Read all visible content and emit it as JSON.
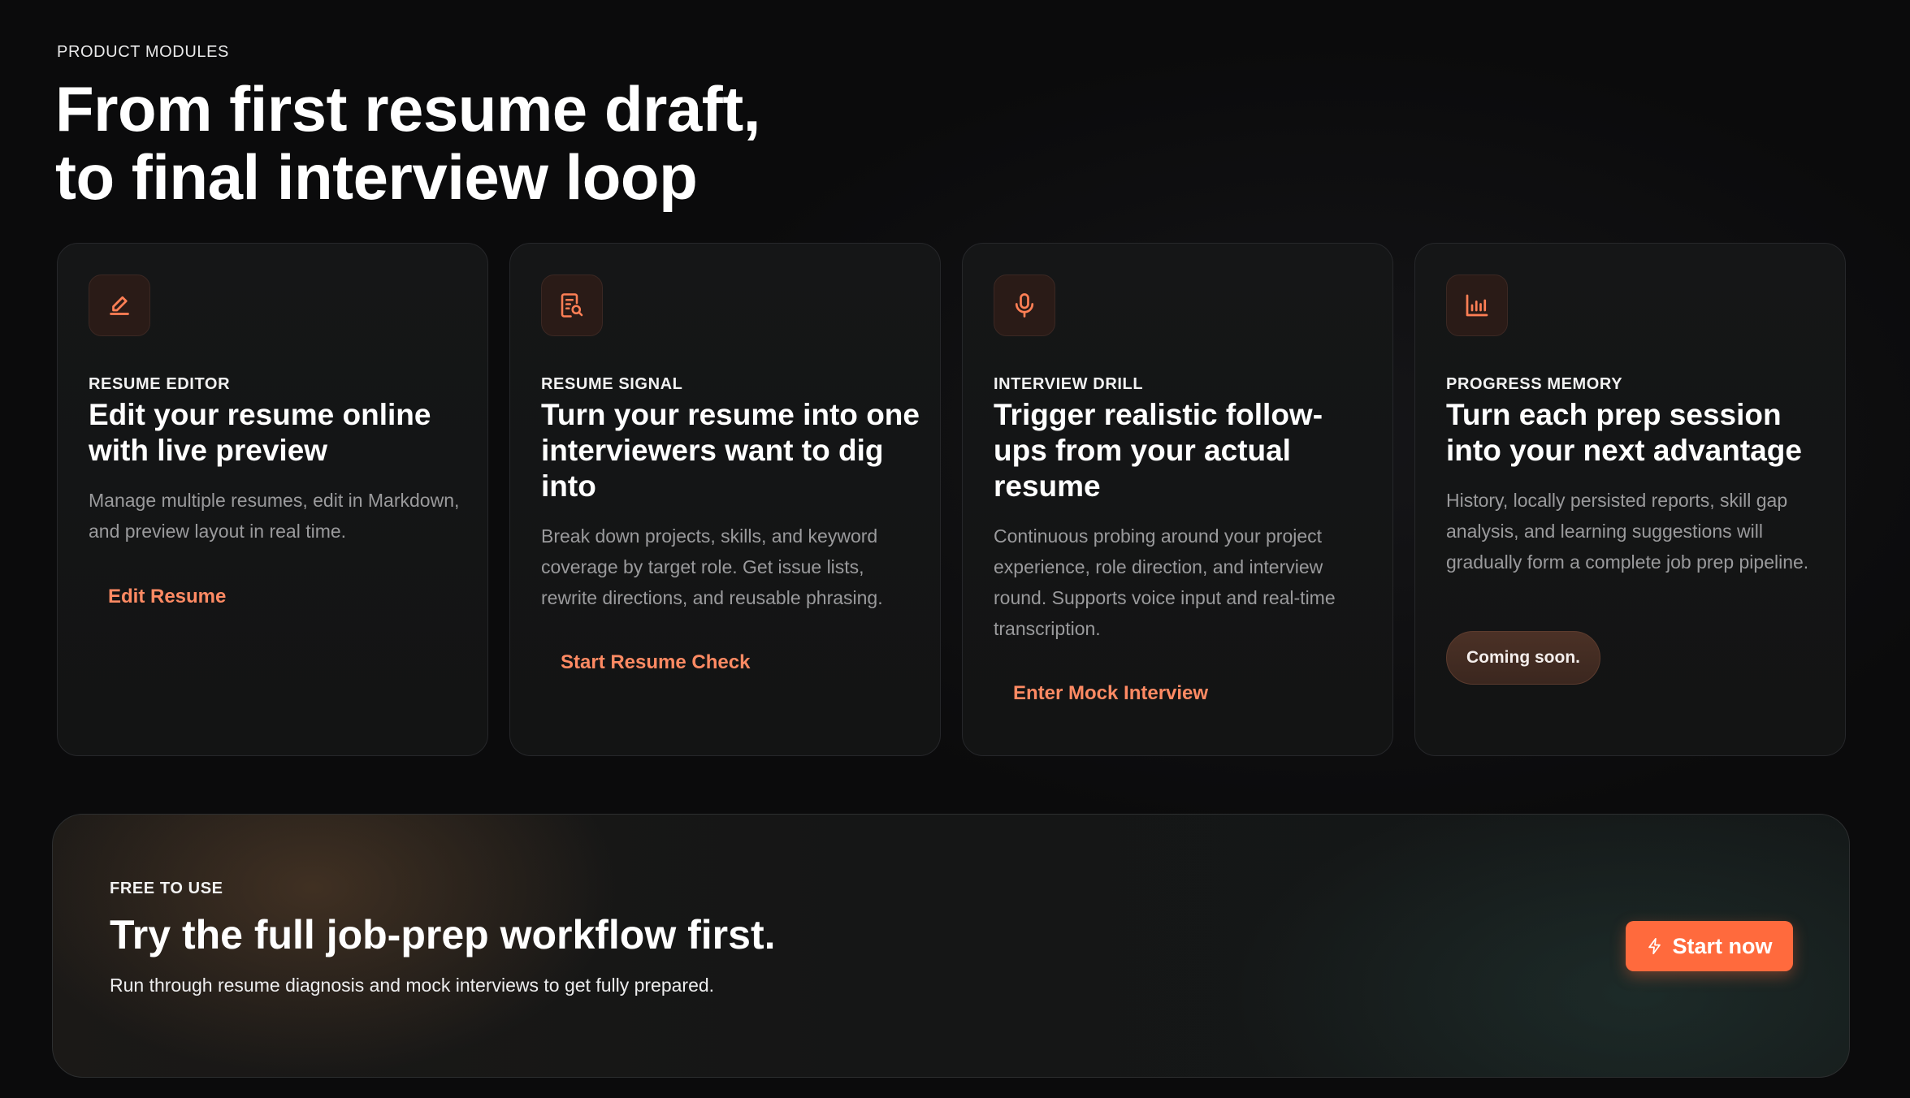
{
  "header": {
    "eyebrow": "PRODUCT MODULES",
    "headline_line1": "From first resume draft,",
    "headline_line2": "to final interview loop"
  },
  "cards": [
    {
      "icon": "pencil-icon",
      "kicker": "RESUME EDITOR",
      "title": "Edit your resume online with live preview",
      "description": "Manage multiple resumes, edit in Markdown, and preview layout in real time.",
      "link_label": "Edit Resume"
    },
    {
      "icon": "resume-search-icon",
      "kicker": "RESUME SIGNAL",
      "title": "Turn your resume into one interviewers want to dig into",
      "description": "Break down projects, skills, and keyword coverage by target role. Get issue lists, rewrite directions, and reusable phrasing.",
      "link_label": "Start Resume Check"
    },
    {
      "icon": "microphone-icon",
      "kicker": "INTERVIEW DRILL",
      "title": "Trigger realistic follow-ups from your actual resume",
      "description": "Continuous probing around your project experience, role direction, and interview round. Supports voice input and real-time transcription.",
      "link_label": "Enter Mock Interview"
    },
    {
      "icon": "bar-chart-icon",
      "kicker": "PROGRESS MEMORY",
      "title": "Turn each prep session into your next advantage",
      "description": "History, locally persisted reports, skill gap analysis, and learning suggestions will gradually form a complete job prep pipeline.",
      "badge_label": "Coming soon."
    }
  ],
  "cta": {
    "eyebrow": "FREE TO USE",
    "title": "Try the full job-prep workflow first.",
    "description": "Run through resume diagnosis and mock interviews to get fully prepared.",
    "button_label": "Start now",
    "button_icon": "lightning-icon"
  },
  "colors": {
    "background": "#0b0b0c",
    "card_background": "#151617",
    "accent": "#ff6a3d",
    "link": "#ff8a63",
    "icon_tile": "#2a1b17"
  }
}
